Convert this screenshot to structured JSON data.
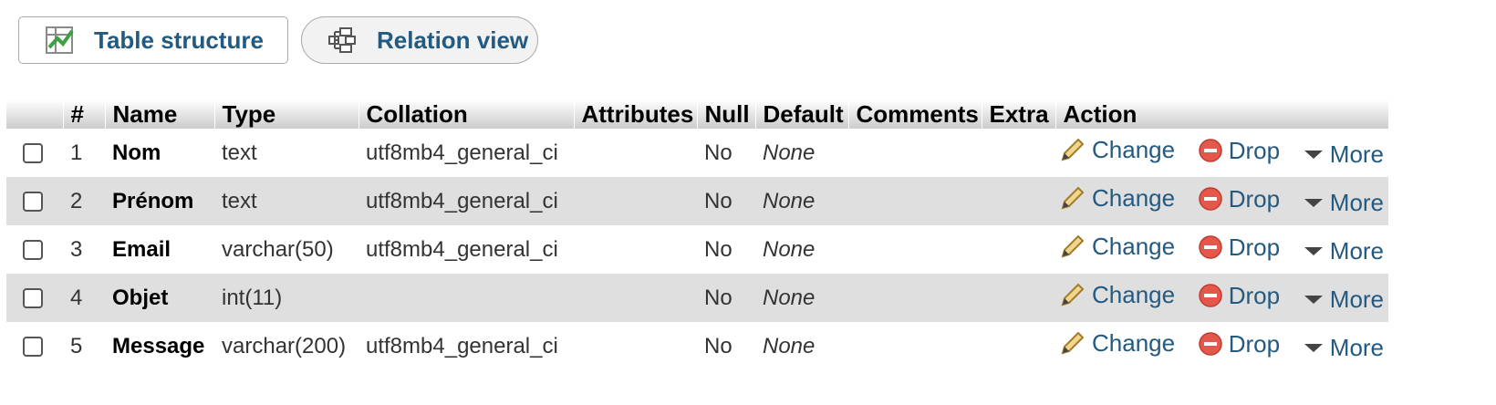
{
  "tabs": [
    {
      "label": "Table structure",
      "icon": "table-structure-icon"
    },
    {
      "label": "Relation view",
      "icon": "relation-view-icon"
    }
  ],
  "columns": [
    "",
    "#",
    "Name",
    "Type",
    "Collation",
    "Attributes",
    "Null",
    "Default",
    "Comments",
    "Extra",
    "Action"
  ],
  "rows": [
    {
      "num": "1",
      "name": "Nom",
      "type": "text",
      "collation": "utf8mb4_general_ci",
      "attributes": "",
      "null": "No",
      "default": "None",
      "comments": "",
      "extra": ""
    },
    {
      "num": "2",
      "name": "Prénom",
      "type": "text",
      "collation": "utf8mb4_general_ci",
      "attributes": "",
      "null": "No",
      "default": "None",
      "comments": "",
      "extra": ""
    },
    {
      "num": "3",
      "name": "Email",
      "type": "varchar(50)",
      "collation": "utf8mb4_general_ci",
      "attributes": "",
      "null": "No",
      "default": "None",
      "comments": "",
      "extra": ""
    },
    {
      "num": "4",
      "name": "Objet",
      "type": "int(11)",
      "collation": "",
      "attributes": "",
      "null": "No",
      "default": "None",
      "comments": "",
      "extra": ""
    },
    {
      "num": "5",
      "name": "Message",
      "type": "varchar(200)",
      "collation": "utf8mb4_general_ci",
      "attributes": "",
      "null": "No",
      "default": "None",
      "comments": "",
      "extra": ""
    }
  ],
  "actions": {
    "change": "Change",
    "drop": "Drop",
    "more": "More"
  },
  "colors": {
    "link": "#235a81",
    "row_alt": "#dfdfdf",
    "drop_icon": "#e4584c"
  }
}
